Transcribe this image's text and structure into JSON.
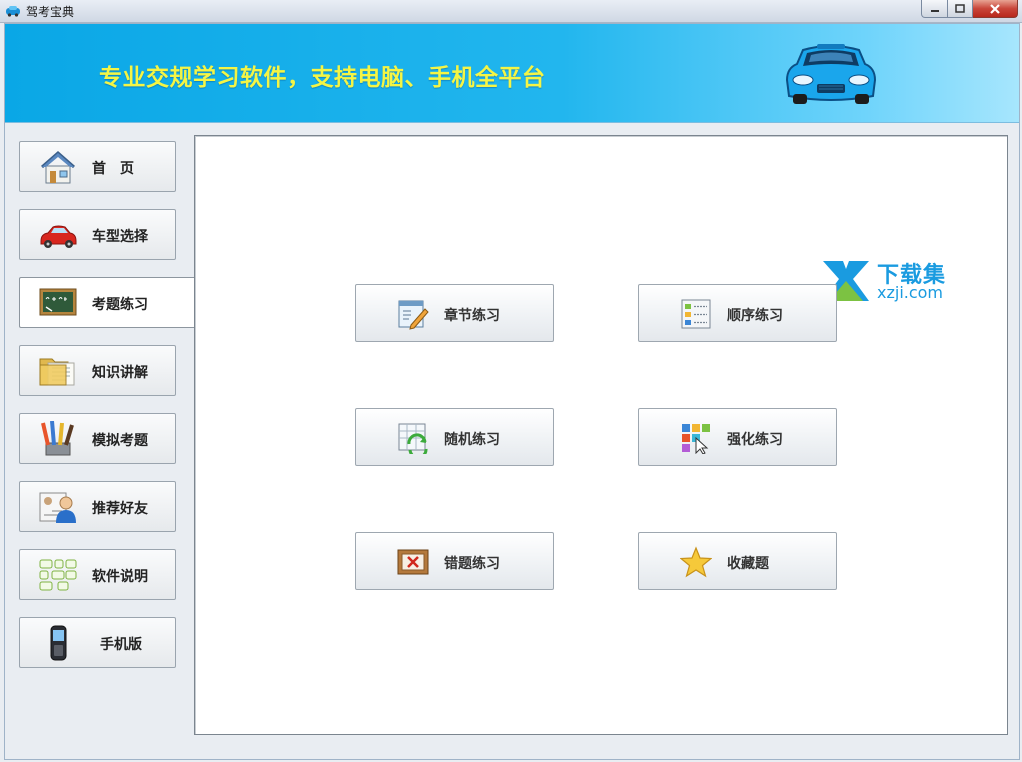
{
  "window": {
    "title": "驾考宝典",
    "minimize_icon": "minimize-icon",
    "maximize_icon": "maximize-icon",
    "close_icon": "close-icon"
  },
  "banner": {
    "slogan": "专业交规学习软件，支持电脑、手机全平台",
    "logo_icon": "sports-car-icon",
    "slogan_color": "#f4f545"
  },
  "sidebar": {
    "items": [
      {
        "label": "首　页",
        "icon": "home-icon",
        "active": false
      },
      {
        "label": "车型选择",
        "icon": "car-icon",
        "active": false
      },
      {
        "label": "考题练习",
        "icon": "chalkboard-icon",
        "active": true
      },
      {
        "label": "知识讲解",
        "icon": "folder-icon",
        "active": false
      },
      {
        "label": "模拟考题",
        "icon": "pencils-icon",
        "active": false
      },
      {
        "label": "推荐好友",
        "icon": "contact-card-icon",
        "active": false
      },
      {
        "label": "软件说明",
        "icon": "flowchart-icon",
        "active": false
      },
      {
        "label": "手机版",
        "icon": "mobile-phone-icon",
        "active": false
      }
    ]
  },
  "main": {
    "tiles": [
      {
        "label": "章节练习",
        "icon": "chapter-edit-icon"
      },
      {
        "label": "顺序练习",
        "icon": "ordered-list-icon"
      },
      {
        "label": "随机练习",
        "icon": "random-refresh-icon"
      },
      {
        "label": "强化练习",
        "icon": "color-grid-cursor-icon"
      },
      {
        "label": "错题练习",
        "icon": "wrong-frame-icon"
      },
      {
        "label": "收藏题",
        "icon": "star-icon"
      }
    ]
  },
  "watermark": {
    "title": "下载集",
    "sub": "xzji.com",
    "color": "#1a9be0"
  }
}
